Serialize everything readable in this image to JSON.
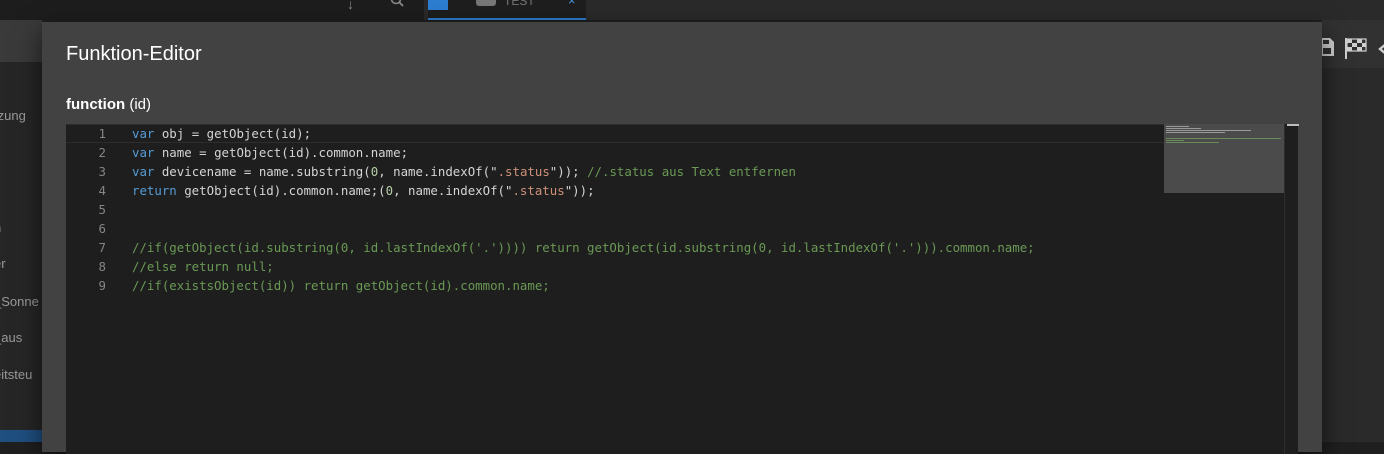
{
  "background": {
    "tab_label": "TEST",
    "sidebar_items": [
      "tzung",
      "n",
      "er",
      "_Sonne",
      "_aus",
      "eitsteu"
    ]
  },
  "dialog": {
    "title": "Funktion-Editor",
    "signature_keyword": "function",
    "signature_params": " (id)"
  },
  "editor": {
    "line_numbers": [
      "1",
      "2",
      "3",
      "4",
      "5",
      "6",
      "7",
      "8",
      "9"
    ],
    "lines": [
      "var obj = getObject(id);",
      "var name = getObject(id).common.name;",
      "var devicename = name.substring(0, name.indexOf(\".status\")); //.status aus Text entfernen",
      "return getObject(id).common.name;(0, name.indexOf(\".status\"));",
      "",
      "",
      "//if(getObject(id.substring(0, id.lastIndexOf('.')))) return getObject(id.substring(0, id.lastIndexOf('.'))).common.name;",
      "//else return null;",
      "//if(existsObject(id)) return getObject(id).common.name;"
    ]
  },
  "colors": {
    "keyword": "#569cd6",
    "string": "#ce9178",
    "number": "#b5cea8",
    "comment": "#6a9955",
    "text": "#d4d4d4",
    "accent": "#2d7dd2"
  },
  "icons": [
    "arrow-down-icon",
    "search-icon",
    "save-icon",
    "flag-icon",
    "more-icon"
  ]
}
